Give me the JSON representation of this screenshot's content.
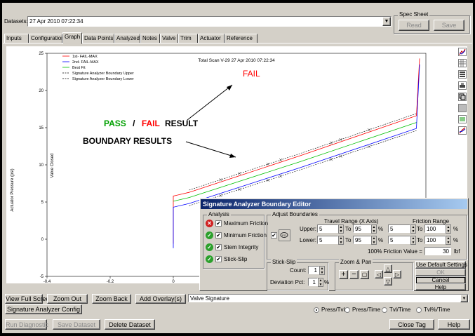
{
  "datasets_label": "Datasets:",
  "dataset_value": "27 Apr 2010 07:22:34",
  "spec_sheet": {
    "title": "Spec Sheet",
    "read": "Read",
    "save": "Save"
  },
  "tabs": [
    "Inputs",
    "Configuration",
    "Graph",
    "Data Points",
    "Analyzed",
    "Notes",
    "Valve",
    "Trim",
    "Actuator",
    "Reference"
  ],
  "active_tab": "Graph",
  "chart_data": {
    "type": "line",
    "title": "Total Scan V-29 27 Apr 2010 07:22:34",
    "ylabel": "Actuator Pressure (psi)",
    "side_label": "Valve Closed",
    "xlim": [
      -0.4,
      0.8
    ],
    "ylim": [
      -5,
      25
    ],
    "xticks": [
      "-0.4",
      "-0.2",
      "0"
    ],
    "yticks": [
      "25",
      "20",
      "15",
      "10",
      "5",
      "0",
      "-5"
    ],
    "legend": [
      {
        "name": "1st- FAIL-MAX",
        "color": "#ff0000",
        "style": "solid"
      },
      {
        "name": "2nd- FAIL-MAX",
        "color": "#0000ff",
        "style": "solid"
      },
      {
        "name": "Best Fit",
        "color": "#00c000",
        "style": "solid"
      },
      {
        "name": "Signature Analyzer Boundary Upper",
        "color": "#000000",
        "style": "dashed"
      },
      {
        "name": "Signature Analyzer Boundary Lower",
        "color": "#000000",
        "style": "dashed"
      }
    ],
    "series": [
      {
        "name": "1st- FAIL-MAX",
        "color": "#ff0000",
        "points": [
          [
            0.0,
            -0.6
          ],
          [
            0.0,
            5.8
          ],
          [
            0.05,
            6.3
          ],
          [
            0.4,
            11.2
          ],
          [
            0.77,
            16.6
          ],
          [
            0.78,
            24.3
          ]
        ]
      },
      {
        "name": "2nd- FAIL-MAX",
        "color": "#0000ff",
        "points": [
          [
            0.0,
            -1.2
          ],
          [
            0.0,
            4.3
          ],
          [
            0.05,
            4.8
          ],
          [
            0.4,
            9.6
          ],
          [
            0.77,
            14.9
          ],
          [
            0.78,
            23.5
          ]
        ]
      },
      {
        "name": "Best Fit",
        "color": "#00c000",
        "points": [
          [
            0.0,
            5.1
          ],
          [
            0.05,
            5.6
          ],
          [
            0.4,
            10.4
          ],
          [
            0.77,
            15.7
          ]
        ]
      },
      {
        "name": "Signature Analyzer Boundary Upper",
        "color": "#000000",
        "dashed": true,
        "points": [
          [
            0.05,
            6.6
          ],
          [
            0.4,
            11.5
          ],
          [
            0.77,
            16.9
          ]
        ]
      },
      {
        "name": "Signature Analyzer Boundary Lower",
        "color": "#000000",
        "dashed": true,
        "points": [
          [
            0.05,
            4.5
          ],
          [
            0.4,
            9.3
          ],
          [
            0.77,
            14.6
          ]
        ]
      }
    ],
    "grid": false,
    "legend_position": "top-left"
  },
  "annotations": {
    "fail": "FAIL",
    "pass": "PASS",
    "sep": "/",
    "fail2": "FAIL",
    "result": "RESULT",
    "boundary": "BOUNDARY RESULTS"
  },
  "toolbar_icons": [
    "chart-type-icon",
    "grid-icon",
    "list-icon",
    "print-icon",
    "copy-icon",
    "disabled-icon",
    "zoom-icon",
    "trend-icon"
  ],
  "bottom": {
    "view_full_screen": "View Full Screen",
    "zoom_out": "Zoom Out",
    "zoom_back": "Zoom Back",
    "add_overlay": "Add Overlay(s)",
    "overlay_value": "Valve Signature",
    "sa_config": "Signature Analyzer Config",
    "radios": [
      "Press/Tvl",
      "Press/Time",
      "Tvl/Time",
      "Tvl%/Time"
    ],
    "selected_radio": "Press/Tvl",
    "run_diag": "Run Diagnostic",
    "save_dataset": "Save Dataset",
    "delete_dataset": "Delete Dataset",
    "close_tag": "Close Tag",
    "help": "Help"
  },
  "dialog": {
    "title": "Signature Analyzer Boundary Editor",
    "analysis_title": "Analysis",
    "analysis_items": [
      {
        "label": "Maximum Friction",
        "status": "fail",
        "checked": true
      },
      {
        "label": "Minimum Friction",
        "status": "pass",
        "checked": true
      },
      {
        "label": "Stem Integrity",
        "status": "pass",
        "checked": true
      },
      {
        "label": "Stick-Slip",
        "status": "pass",
        "checked": true
      }
    ],
    "adjust_title": "Adjust Boundaries",
    "travel_range": "Travel Range (X Axis)",
    "friction_range": "Friction Range",
    "upper": "Upper:",
    "lower": "Lower:",
    "to": "To",
    "pct": "%",
    "upper_vals": [
      "5",
      "95",
      "5",
      "100"
    ],
    "lower_vals": [
      "5",
      "95",
      "5",
      "100"
    ],
    "friction_value_label": "100% Friction Value =",
    "friction_value": "30",
    "friction_unit": "lbf",
    "stick_title": "Stick-Slip",
    "count_label": "Count:",
    "count_value": "1",
    "dev_label": "Deviation Pct:",
    "dev_value": "1",
    "zoom_title": "Zoom & Pan",
    "use_default": "Use Default Settings",
    "ok": "OK",
    "cancel": "Cancel",
    "help": "Help"
  }
}
